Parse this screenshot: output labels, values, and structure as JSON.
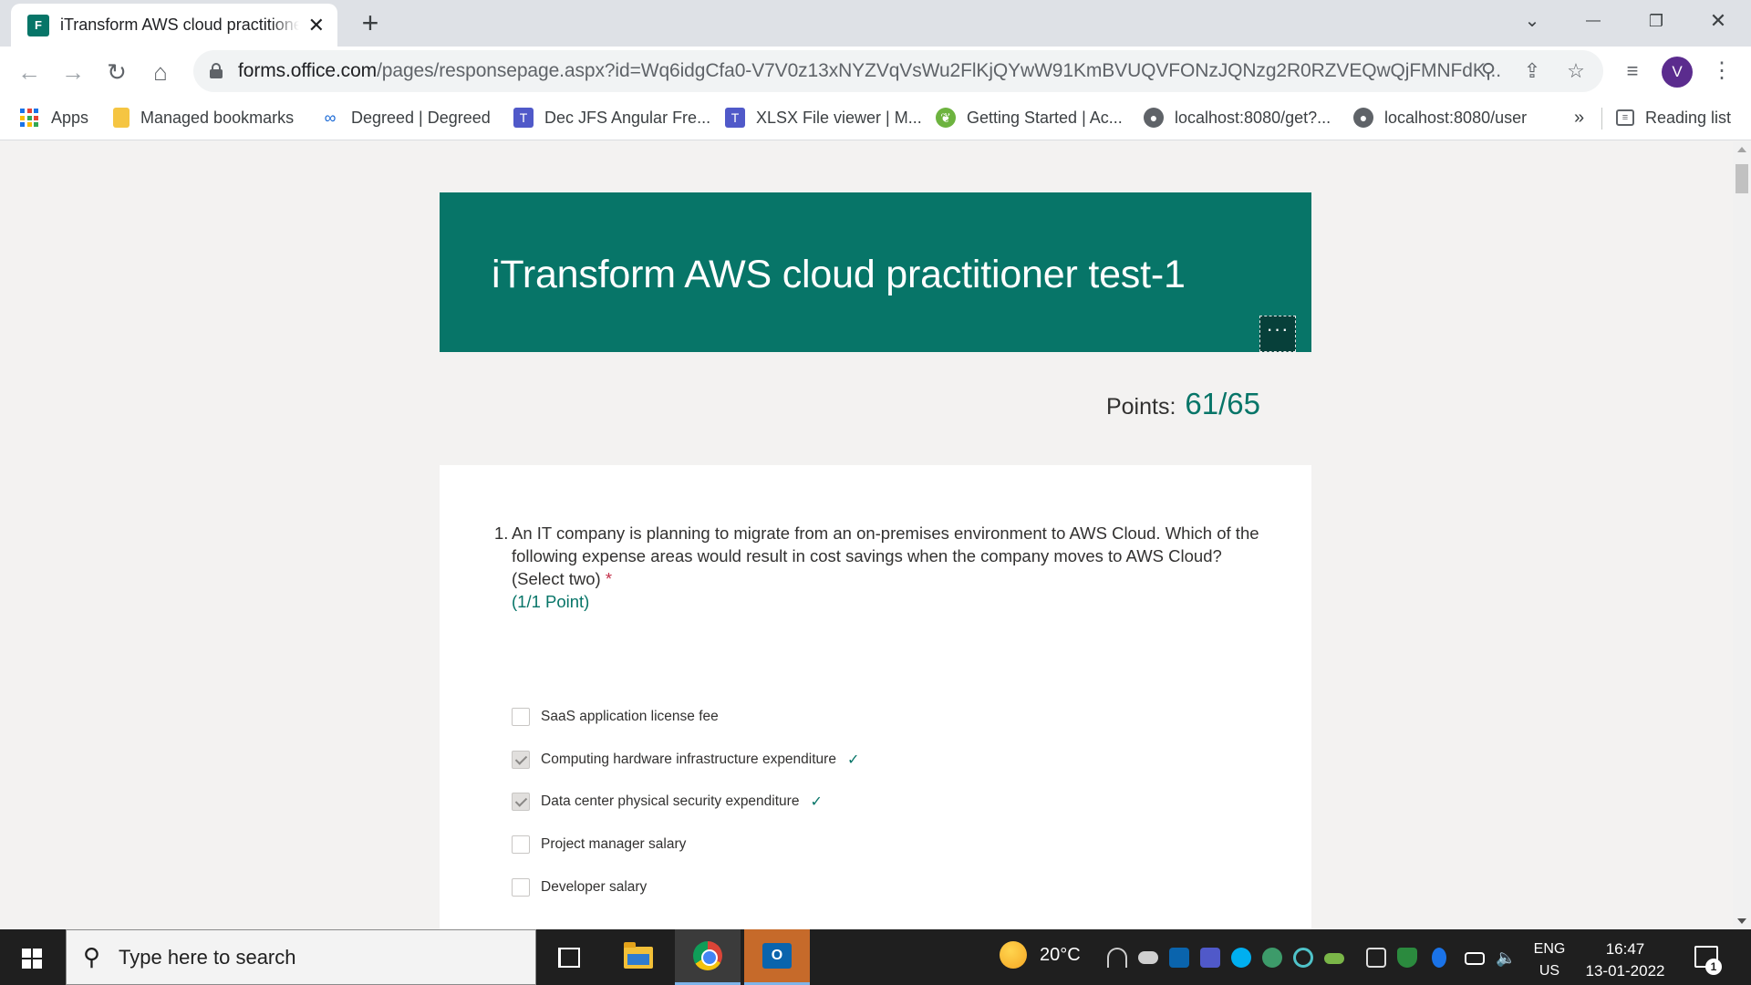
{
  "browser": {
    "tab": {
      "title": "iTransform AWS cloud practitioner test-1",
      "close": "✕"
    },
    "new_tab": "+",
    "window_controls": {
      "dropdown": "⌄",
      "minimize": "—",
      "restore": "❐",
      "close": "✕"
    },
    "url": {
      "host": "forms.office.com",
      "path": "/pages/responsepage.aspx?id=Wq6idgCfa0-V7V0z13xNYZVqVsWu2FlKjQYwW91KmBVUQVFONzJQNzg2R0RZVEQwQjFMNFdK..."
    },
    "profile_initial": "V",
    "bookmarks": [
      {
        "label": "Apps",
        "icon": "apps-grid-icon"
      },
      {
        "label": "Managed bookmarks",
        "icon": "folder-icon"
      },
      {
        "label": "Degreed | Degreed",
        "icon": "degreed-icon"
      },
      {
        "label": "Dec JFS Angular Fre...",
        "icon": "teams-icon"
      },
      {
        "label": "XLSX File viewer | M...",
        "icon": "teams-icon"
      },
      {
        "label": "Getting Started | Ac...",
        "icon": "spring-icon"
      },
      {
        "label": "localhost:8080/get?...",
        "icon": "globe-icon"
      },
      {
        "label": "localhost:8080/user",
        "icon": "globe-icon"
      }
    ],
    "bookmarks_overflow": "»",
    "reading_list": "Reading list"
  },
  "form": {
    "title": "iTransform AWS cloud practitioner test-1",
    "more_button": "···",
    "points_label": "Points:",
    "points_value": "61/65",
    "question": {
      "number": "1.",
      "text": "An IT company is planning to migrate from an on-premises environment to AWS Cloud. Which of the following expense areas would result in cost savings when the company moves to AWS Cloud?",
      "instruction": "(Select two)",
      "required_marker": "*",
      "points": "(1/1 Point)",
      "options": [
        {
          "label": "SaaS application license fee",
          "checked": false,
          "correct": false
        },
        {
          "label": "Computing hardware infrastructure expenditure",
          "checked": true,
          "correct": true
        },
        {
          "label": "Data center physical security expenditure",
          "checked": true,
          "correct": true
        },
        {
          "label": "Project manager salary",
          "checked": false,
          "correct": false
        },
        {
          "label": "Developer salary",
          "checked": false,
          "correct": false
        }
      ],
      "correct_mark": "✓"
    },
    "next_result_icon": "✕"
  },
  "taskbar": {
    "search_placeholder": "Type here to search",
    "weather_temp": "20°C",
    "language": {
      "line1": "ENG",
      "line2": "US"
    },
    "clock": {
      "time": "16:47",
      "date": "13-01-2022"
    },
    "notification_count": "1"
  }
}
